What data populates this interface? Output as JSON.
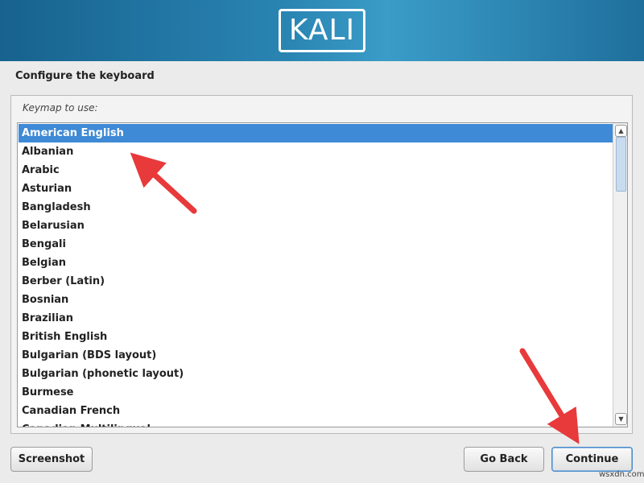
{
  "banner": {
    "logo_text": "KALI"
  },
  "page": {
    "title": "Configure the keyboard"
  },
  "keymap": {
    "label": "Keymap to use:",
    "items": [
      "American English",
      "Albanian",
      "Arabic",
      "Asturian",
      "Bangladesh",
      "Belarusian",
      "Bengali",
      "Belgian",
      "Berber (Latin)",
      "Bosnian",
      "Brazilian",
      "British English",
      "Bulgarian (BDS layout)",
      "Bulgarian (phonetic layout)",
      "Burmese",
      "Canadian French",
      "Canadian Multilingual"
    ],
    "selected": "American English"
  },
  "buttons": {
    "screenshot": "Screenshot",
    "go_back": "Go Back",
    "continue": "Continue"
  },
  "watermark": "wsxdn.com",
  "colors": {
    "banner": "#2a85b3",
    "selection": "#3e8ad6",
    "annotation_arrow": "#e8393b"
  },
  "icons": {
    "scroll_up": "chevron-up-icon",
    "scroll_down": "chevron-down-icon"
  }
}
